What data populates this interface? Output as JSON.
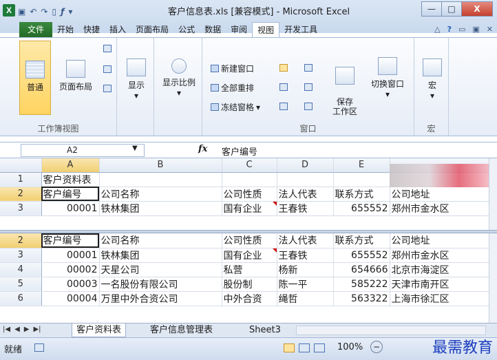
{
  "window": {
    "title": "客户信息表.xls  [兼容模式] - Microsoft Excel",
    "app_icon": "X",
    "minimize": "—",
    "maximize": "□",
    "close": "X"
  },
  "quickaccess": [
    "save-icon",
    "undo-icon",
    "redo-icon",
    "new-icon",
    "fx-icon",
    "customize-icon"
  ],
  "tabs": [
    "文件",
    "开始",
    "快捷",
    "插入",
    "页面布局",
    "公式",
    "数据",
    "审阅",
    "视图",
    "开发工具"
  ],
  "active_tab": "视图",
  "ribbon": {
    "workbook_views": {
      "label": "工作簿视图",
      "normal": "普通",
      "page_layout": "页面布局"
    },
    "show": {
      "label": "显示"
    },
    "zoom": {
      "label": "显示比例"
    },
    "window": {
      "label": "窗口",
      "new_window": "新建窗口",
      "arrange_all": "全部重排",
      "freeze_panes": "冻结窗格",
      "save_workspace": "保存\n工作区",
      "switch_windows": "切换窗口"
    },
    "macros": {
      "label": "宏",
      "macro": "宏"
    }
  },
  "formula_bar": {
    "name_box": "A2",
    "fx": "fx",
    "value": "客户编号"
  },
  "columns": [
    "A",
    "B",
    "C",
    "D",
    "E"
  ],
  "top_pane": {
    "rows": [
      {
        "n": "1",
        "cells": [
          "客户资料表",
          "",
          "",
          "",
          "",
          ""
        ]
      },
      {
        "n": "2",
        "cells": [
          "客户编号",
          "公司名称",
          "公司性质",
          "法人代表",
          "联系方式",
          "公司地址"
        ]
      },
      {
        "n": "3",
        "cells": [
          "00001",
          "铁林集团",
          "国有企业",
          "王春铁",
          "655552",
          "郑州市金水区"
        ]
      }
    ]
  },
  "bottom_pane": {
    "rows": [
      {
        "n": "2",
        "cells": [
          "客户编号",
          "公司名称",
          "公司性质",
          "法人代表",
          "联系方式",
          "公司地址"
        ]
      },
      {
        "n": "3",
        "cells": [
          "00001",
          "铁林集团",
          "国有企业",
          "王春铁",
          "655552",
          "郑州市金水区"
        ]
      },
      {
        "n": "4",
        "cells": [
          "00002",
          "天星公司",
          "私营",
          "杨新",
          "654666",
          "北京市海淀区"
        ]
      },
      {
        "n": "5",
        "cells": [
          "00003",
          "一名股份有限公司",
          "股份制",
          "陈一平",
          "585222",
          "天津市南开区"
        ]
      },
      {
        "n": "6",
        "cells": [
          "00004",
          "万里中外合资公司",
          "中外合资",
          "绳哲",
          "563322",
          "上海市徐汇区"
        ]
      }
    ]
  },
  "sheets": [
    "客户资料表",
    "客户信息管理表",
    "Sheet3"
  ],
  "active_sheet": "客户资料表",
  "status": {
    "ready": "就绪",
    "zoom": "100%"
  },
  "watermark": "最需教育"
}
